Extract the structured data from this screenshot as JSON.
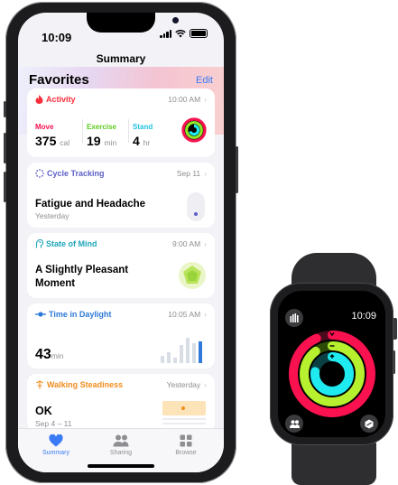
{
  "status": {
    "time": "10:09"
  },
  "nav": {
    "title": "Summary"
  },
  "favorites": {
    "title": "Favorites",
    "edit": "Edit"
  },
  "activity": {
    "title": "Activity",
    "time": "10:00 AM",
    "move": {
      "label": "Move",
      "value": "375",
      "unit": "cal"
    },
    "exercise": {
      "label": "Exercise",
      "value": "19",
      "unit": "min"
    },
    "stand": {
      "label": "Stand",
      "value": "4",
      "unit": "hr"
    }
  },
  "cycle": {
    "title": "Cycle Tracking",
    "date": "Sep 11",
    "headline": "Fatigue and Headache",
    "sub": "Yesterday"
  },
  "mind": {
    "title": "State of Mind",
    "time": "9:00 AM",
    "headline_1": "A Slightly Pleasant",
    "headline_2": "Moment"
  },
  "daylight": {
    "title": "Time in Daylight",
    "time": "10:05 AM",
    "value": "43",
    "unit": "min"
  },
  "walking": {
    "title": "Walking Steadiness",
    "date": "Yesterday",
    "value": "OK",
    "sub": "Sep 4 – 11"
  },
  "tabs": [
    {
      "label": "Summary"
    },
    {
      "label": "Sharing"
    },
    {
      "label": "Browse"
    }
  ],
  "watch": {
    "time": "10:09"
  },
  "colors": {
    "move": "#fa114f",
    "exercise": "#92e82a",
    "stand": "#1eeaef",
    "accent": "#3a7bf6"
  },
  "icons": [
    "flame-icon",
    "cycle-icon",
    "mind-icon",
    "daylight-icon",
    "walking-icon",
    "heart-icon",
    "sharing-icon",
    "browse-icon"
  ]
}
